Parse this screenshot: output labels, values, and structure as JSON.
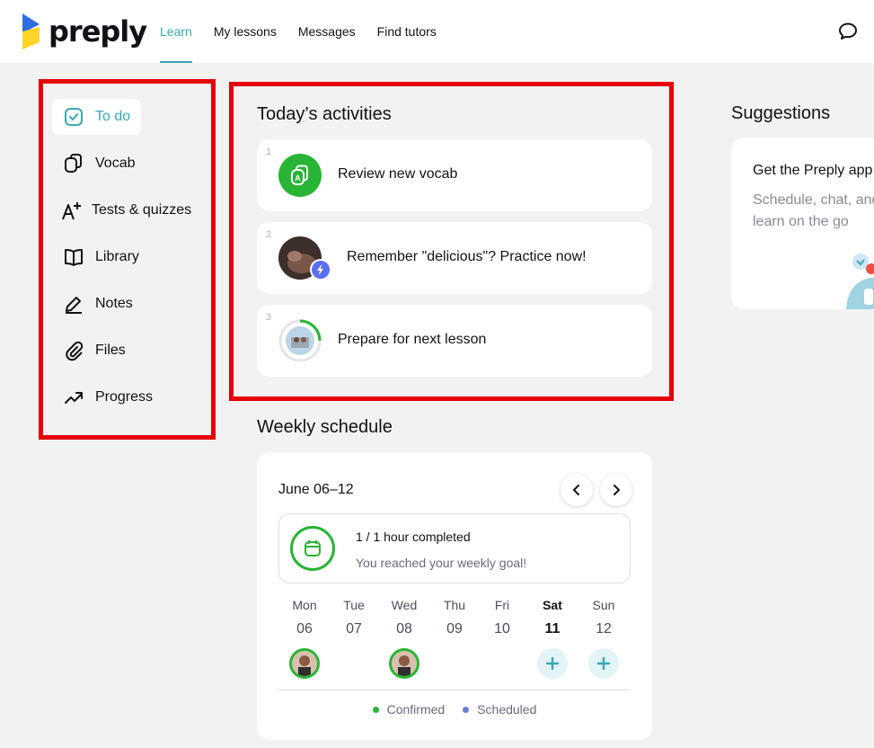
{
  "header": {
    "logo_text": "preply",
    "nav": [
      {
        "label": "Learn",
        "active": true
      },
      {
        "label": "My lessons",
        "active": false
      },
      {
        "label": "Messages",
        "active": false
      },
      {
        "label": "Find tutors",
        "active": false
      }
    ],
    "right_icon": "chat-bubble-icon"
  },
  "sidebar": {
    "items": [
      {
        "label": "To do",
        "icon": "checkbox-icon",
        "active": true
      },
      {
        "label": "Vocab",
        "icon": "cards-icon",
        "active": false
      },
      {
        "label": "Tests & quizzes",
        "icon": "a-plus-icon",
        "active": false
      },
      {
        "label": "Library",
        "icon": "book-icon",
        "active": false
      },
      {
        "label": "Notes",
        "icon": "pencil-icon",
        "active": false
      },
      {
        "label": "Files",
        "icon": "paperclip-icon",
        "active": false
      },
      {
        "label": "Progress",
        "icon": "trend-up-icon",
        "active": false
      }
    ]
  },
  "activities": {
    "title": "Today’s activities",
    "items": [
      {
        "number": "1",
        "text": "Review new vocab",
        "icon": "vocab-cards-icon"
      },
      {
        "number": "2",
        "text": "Remember \"delicious\"? Practice now!",
        "icon": "lightning-badge-icon"
      },
      {
        "number": "3",
        "text": "Prepare for next lesson",
        "icon": "lesson-progress-icon"
      }
    ]
  },
  "weekly": {
    "title": "Weekly schedule",
    "range": "June 06–12",
    "goal_main": "1 / 1 hour completed",
    "goal_sub": "You reached your weekly goal!",
    "days": [
      {
        "name": "Mon",
        "date": "06",
        "slot": "avatar",
        "bold": false
      },
      {
        "name": "Tue",
        "date": "07",
        "slot": "none",
        "bold": false
      },
      {
        "name": "Wed",
        "date": "08",
        "slot": "avatar",
        "bold": false
      },
      {
        "name": "Thu",
        "date": "09",
        "slot": "none",
        "bold": false
      },
      {
        "name": "Fri",
        "date": "10",
        "slot": "none",
        "bold": false
      },
      {
        "name": "Sat",
        "date": "11",
        "slot": "plus",
        "bold": true
      },
      {
        "name": "Sun",
        "date": "12",
        "slot": "plus",
        "bold": false
      }
    ],
    "legend": [
      {
        "label": "Confirmed",
        "color": "#28b435"
      },
      {
        "label": "Scheduled",
        "color": "#6b7fd6"
      }
    ]
  },
  "suggestions": {
    "title": "Suggestions",
    "card_title": "Get the Preply app",
    "card_body": "Schedule, chat, and learn on the go"
  },
  "colors": {
    "accent": "#3aa7b1",
    "green": "#28b435",
    "highlight_frame": "#e5000b"
  }
}
